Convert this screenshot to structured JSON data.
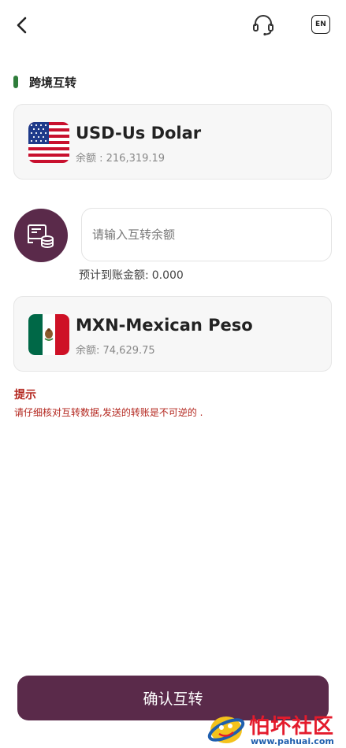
{
  "header": {
    "lang_label": "EN"
  },
  "section": {
    "title": "跨境互转"
  },
  "from_currency": {
    "name": "USD-Us Dolar",
    "balance": "余额 : 216,319.19"
  },
  "transfer": {
    "input_placeholder": "请输入互转余额",
    "expected_label": "预计到账金额:",
    "expected_value": "0.000"
  },
  "to_currency": {
    "name": "MXN-Mexican Peso",
    "balance": "余额: 74,629.75"
  },
  "notice": {
    "title": "提示",
    "text": "请仔细核对互转数据,发送的转账是不可逆的 ."
  },
  "actions": {
    "confirm_label": "确认互转"
  },
  "watermark": {
    "title": "怕坏社区",
    "url": "www.pahuai.com"
  },
  "colors": {
    "primary": "#5a2a4a",
    "accent_green": "#2f7d3b",
    "warning_red": "#b3261e"
  },
  "icons": {
    "back": "chevron-left-icon",
    "support": "headset-icon",
    "swap": "exchange-coins-icon"
  }
}
